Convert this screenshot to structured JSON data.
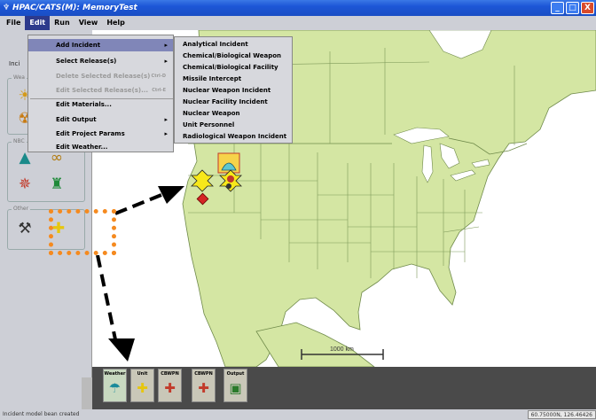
{
  "window": {
    "title": "HPAC/CATS(M): MemoryTest",
    "minimize": "_",
    "maximize": "□",
    "close": "X"
  },
  "menubar": [
    "File",
    "Edit",
    "Run",
    "View",
    "Help"
  ],
  "edit_menu": [
    {
      "label": "Add Incident",
      "arrow": "▸",
      "highlighted": true
    },
    {
      "label": "Select Release(s)",
      "arrow": "▸"
    },
    {
      "label": "Delete Selected Release(s)",
      "shortcut": "Ctrl-D",
      "disabled": true
    },
    {
      "label": "Edit Selected Release(s)...",
      "shortcut": "Ctrl-E",
      "disabled": true
    },
    {
      "label": "Edit Materials..."
    },
    {
      "label": "Edit Output",
      "arrow": "▸"
    },
    {
      "label": "Edit Project Params",
      "arrow": "▸"
    },
    {
      "label": "Edit Weather..."
    }
  ],
  "add_incident_submenu": [
    "Analytical Incident",
    "Chemical/Biological Weapon",
    "Chemical/Biological Facility",
    "Missile Intercept",
    "Nuclear Weapon Incident",
    "Nuclear Facility Incident",
    "Nuclear Weapon",
    "Unit Personnel",
    "Radiological Weapon Incident"
  ],
  "left_panel": {
    "partial_label": "Inci",
    "group_labels": [
      "Wea",
      "NBC",
      "Other"
    ]
  },
  "bottom_toolbar": [
    "Weather",
    "Unit",
    "CBWPN",
    "CBWPN",
    "Output"
  ],
  "map": {
    "scale_label": "1000 km"
  },
  "status": {
    "message": "Incident model bean created",
    "coordinates": "60.75000N, 126.46426"
  },
  "icons": {
    "title": "app-icon",
    "toolbar": [
      "move-icon",
      "layers-icon"
    ],
    "left_panel": [
      "weather-incident-icon",
      "nuclear-incident-icon",
      "tower-icon",
      "chem-icon",
      "satellite-icon",
      "facility-icon",
      "tools-icon",
      "unit-icon"
    ],
    "map_markers": [
      "terrain-marker-icon",
      "unit-marker-icon",
      "cbwpn-marker-icon",
      "facility-marker-icon"
    ],
    "bottom": [
      "weather-icon",
      "unit-icon",
      "cbwpn-icon",
      "cbwpn-icon",
      "output-icon"
    ]
  },
  "colors": {
    "title_bar": "#1c56d6",
    "menu_highlight": "#8086b8",
    "annotation_orange": "#f58a1f",
    "land": "#d4e6a3",
    "water": "#ffffff",
    "unit_yellow": "#f7e81a"
  }
}
